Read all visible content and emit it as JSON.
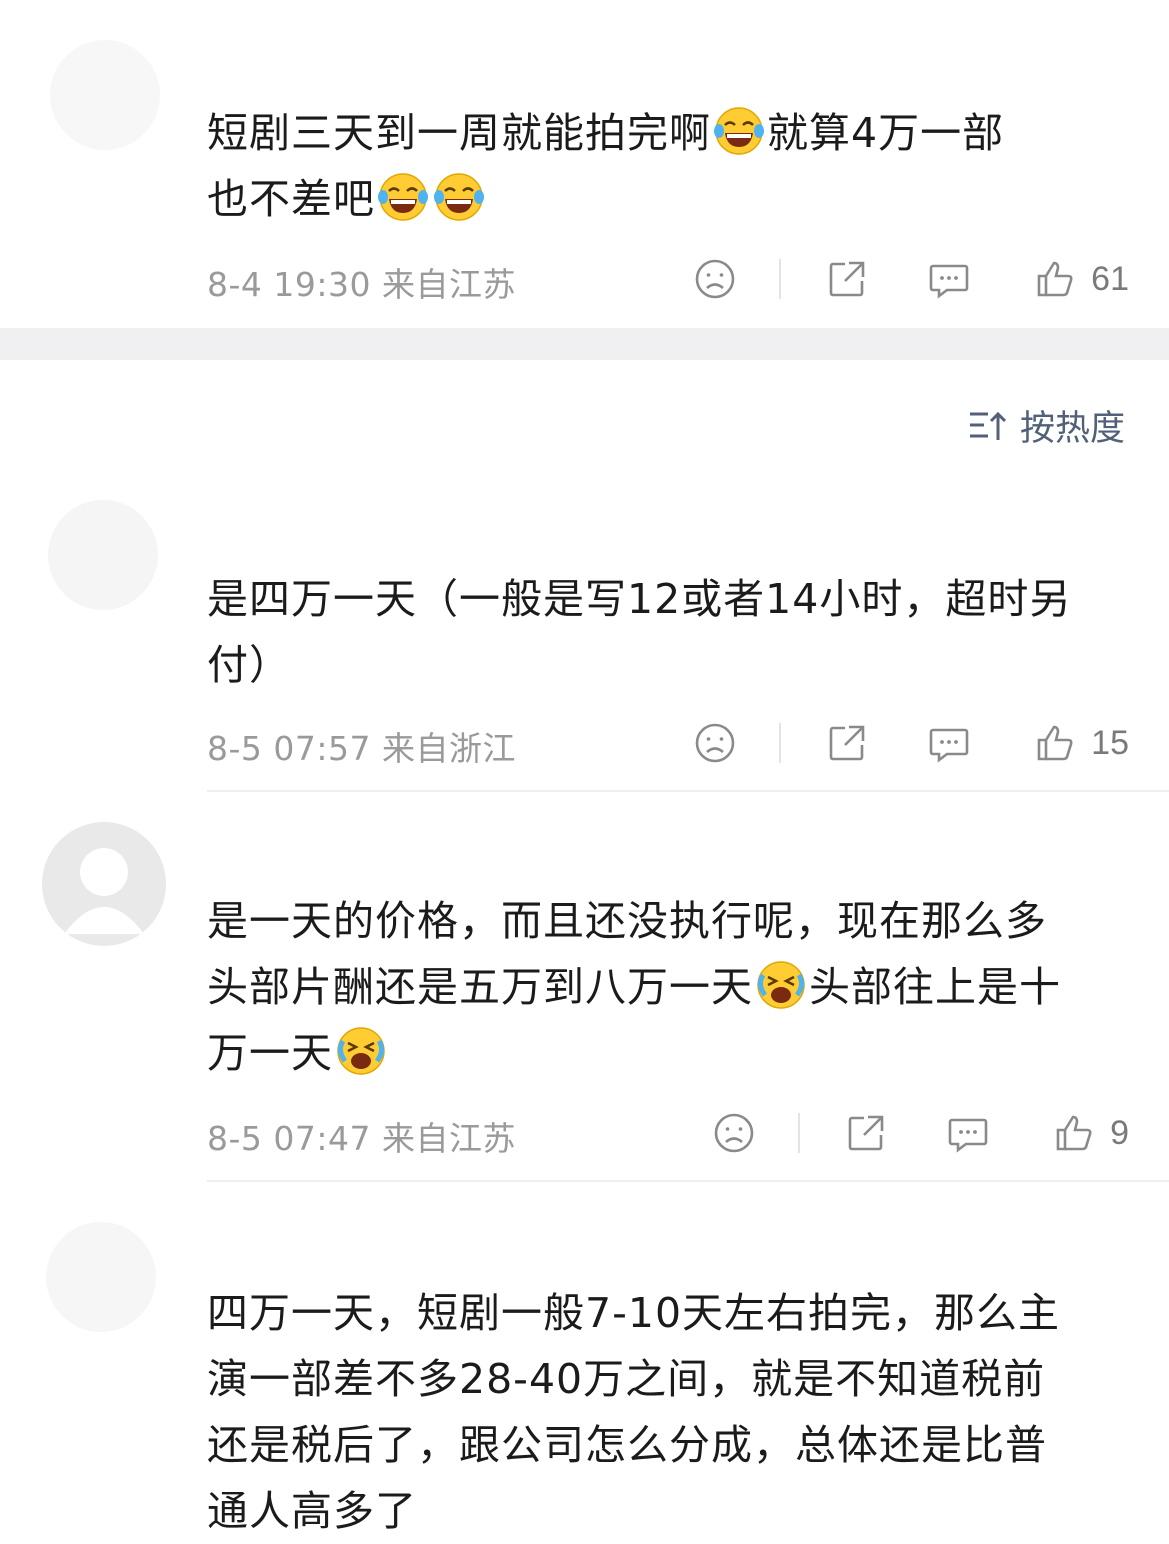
{
  "sort": {
    "label": "按热度"
  },
  "comments": [
    {
      "text_a": "短剧三天到一周就能拍完啊",
      "text_b": "就算4万一部",
      "text_c": "也不差吧",
      "meta": "8-4 19:30 来自江苏",
      "likes": "61"
    },
    {
      "text_a": "是四万一天（一般是写12或者14小时，超时另",
      "text_b": "付）",
      "meta": "8-5 07:57 来自浙江",
      "likes": "15"
    },
    {
      "text_a": "是一天的价格，而且还没执行呢，现在那么多",
      "text_b": "头部片酬还是五万到八万一天",
      "text_c": "头部往上是十",
      "text_d": "万一天",
      "meta": "8-5 07:47 来自江苏",
      "likes": "9"
    },
    {
      "text_a": "四万一天，短剧一般7-10天左右拍完，那么主",
      "text_b": "演一部差不多28-40万之间，就是不知道税前",
      "text_c": "还是税后了，跟公司怎么分成，总体还是比普",
      "text_d": "通人高多了"
    }
  ],
  "icons": [
    "dislike-icon",
    "share-icon",
    "comment-icon",
    "like-icon",
    "sort-icon",
    "laugh-cry-emoji",
    "crying-laugh-emoji"
  ]
}
